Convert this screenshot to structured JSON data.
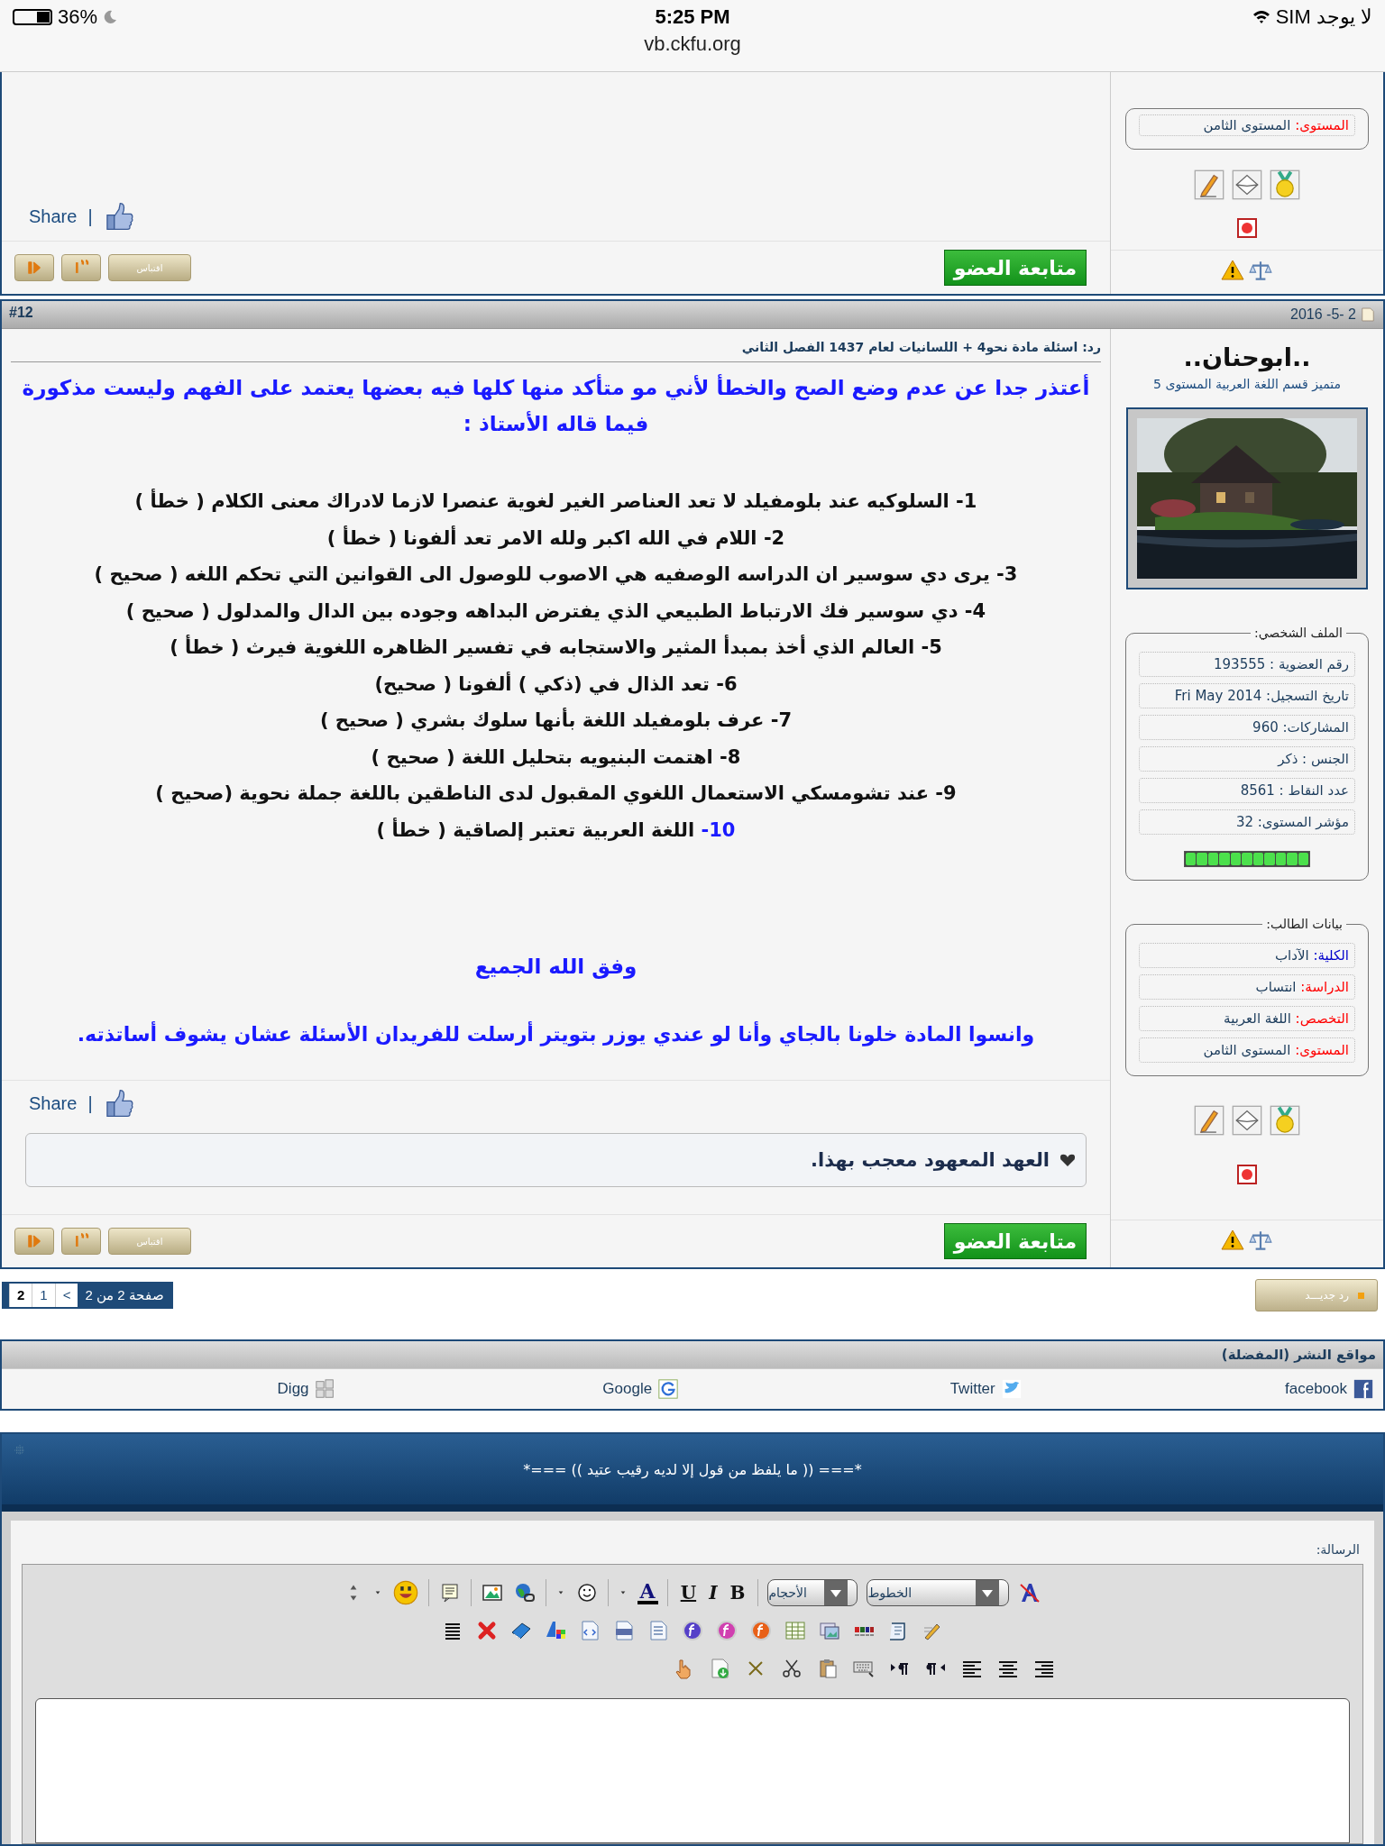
{
  "status_bar": {
    "battery": "36%",
    "time": "5:25 PM",
    "url": "vb.ckfu.org",
    "carrier": "لا يوجد SIM"
  },
  "previous_post": {
    "profile_tail": [
      {
        "label": "المستوى:",
        "value": "المستوى الثامن",
        "color": "#ff0000"
      }
    ],
    "share": "Share",
    "share_separator": "|",
    "quote_label": "اقتباس",
    "follow_button": "متابعة العضو"
  },
  "post": {
    "number": "#12",
    "date": "2016 -5- 2",
    "title": "رد: اسئلة مادة نحو4 + اللسانيات لعام 1437 الفصل الثاني",
    "intro": "أعتذر جدا عن عدم وضع الصح والخطأ لأني مو متأكد منها كلها فيه بعضها يعتمد على الفهم وليست مذكورة فيما قاله الأستاذ :",
    "items": [
      {
        "number": "1-",
        "text": "السلوكيه عند بلومفيلد لا تعد العناصر الغير لغوية عنصرا لازما لادراك معنى الكلام ( خطأ )",
        "number_marked": false
      },
      {
        "number": "2-",
        "text": "اللام في الله اكبر ولله الامر تعد ألفونا ( خطأ )",
        "number_marked": false
      },
      {
        "number": "3-",
        "text": "يرى دي سوسير ان الدراسه الوصفيه هي الاصوب للوصول الى القوانين التي تحكم اللغه ( صحيح )",
        "number_marked": false
      },
      {
        "number": "4-",
        "text": "دي سوسير فك الارتباط الطبيعي الذي يفترض البداهه وجوده بين الدال والمدلول ( صحيح )",
        "number_marked": false
      },
      {
        "number": "5-",
        "text": "العالم الذي أخذ بمبدأ المثير والاستجابه في تفسير الظاهره اللغوية فيرث ( خطأ )",
        "number_marked": false
      },
      {
        "number": "6-",
        "text": "تعد الذال في (ذكي ) ألفونا ( صحيح)",
        "number_marked": false
      },
      {
        "number": "7-",
        "text": "عرف بلومفيلد اللغة بأنها سلوك بشري ( صحيح )",
        "number_marked": false
      },
      {
        "number": "8-",
        "text": "اهتمت البنيويه بتحليل اللغة ( صحيح )",
        "number_marked": false
      },
      {
        "number": "9-",
        "text": "عند تشومسكي الاستعمال اللغوي المقبول لدى الناطقين باللغة جملة نحوية (صحيح )",
        "number_marked": false
      },
      {
        "number": "10-",
        "text": "اللغة العربية تعتبر إلصاقية ( خطأ )",
        "number_marked": true
      }
    ],
    "closing": "وفق الله الجميع",
    "footer_note": "وانسوا المادة خلونا بالجاي وأنا لو عندي يوزر بتويتر أرسلت للفريدان الأسئلة عشان يشوف أساتذته.",
    "share": "Share",
    "share_separator": "|",
    "likes": "العهد المعهود معجب بهذا.",
    "quote_label": "اقتباس",
    "follow_button": "متابعة العضو",
    "author": {
      "username": "..ابوحنان..",
      "rank": "متميز قسم اللغة العربية المستوى 5",
      "profile_title": "الملف الشخصي:",
      "profile": [
        "رقم العضوية : 193555",
        "تاريخ التسجيل: Fri May 2014",
        "المشاركات: 960",
        "الجنس : ذكر",
        "عدد النقاط : 8561",
        "مؤشر المستوى: 32"
      ],
      "level_meter": {
        "level": 1
      },
      "student_title": "بيانات الطالب:",
      "student": [
        {
          "label": "الكلية:",
          "value": "الآداب",
          "color": "#0000cc"
        },
        {
          "label": "الدراسة:",
          "value": "انتساب",
          "color": "#ff0000"
        },
        {
          "label": "التخصص:",
          "value": "اللغة العربية",
          "color": "#ff0000"
        },
        {
          "label": "المستوى:",
          "value": "المستوى الثامن",
          "color": "#ff0000"
        }
      ]
    }
  },
  "pagination": {
    "info": "صفحة 2 من 2",
    "next": ">",
    "pages": [
      {
        "label": "1",
        "selected": false
      },
      {
        "label": "2",
        "selected": true
      }
    ],
    "reply_button": "رد جديـــد"
  },
  "share_sites": {
    "title": "مواقع النشر (المفضلة)",
    "sites": [
      {
        "name": "facebook",
        "kind": "facebook"
      },
      {
        "name": "Twitter",
        "kind": "twitter"
      },
      {
        "name": "Google",
        "kind": "google"
      },
      {
        "name": "Digg",
        "kind": "digg"
      }
    ]
  },
  "editor": {
    "banner": "*=== (( ما يلفظ من قول إلا لديه رقيب عتيد )) ===*",
    "label": "الرسالة:",
    "font_dropdown": "الخطوط",
    "size_dropdown": "الأحجام",
    "font_color": "A",
    "format_buttons": [
      {
        "label": "B",
        "kind": "bold"
      },
      {
        "label": "I",
        "kind": "italic"
      },
      {
        "label": "U",
        "kind": "underline"
      }
    ]
  }
}
